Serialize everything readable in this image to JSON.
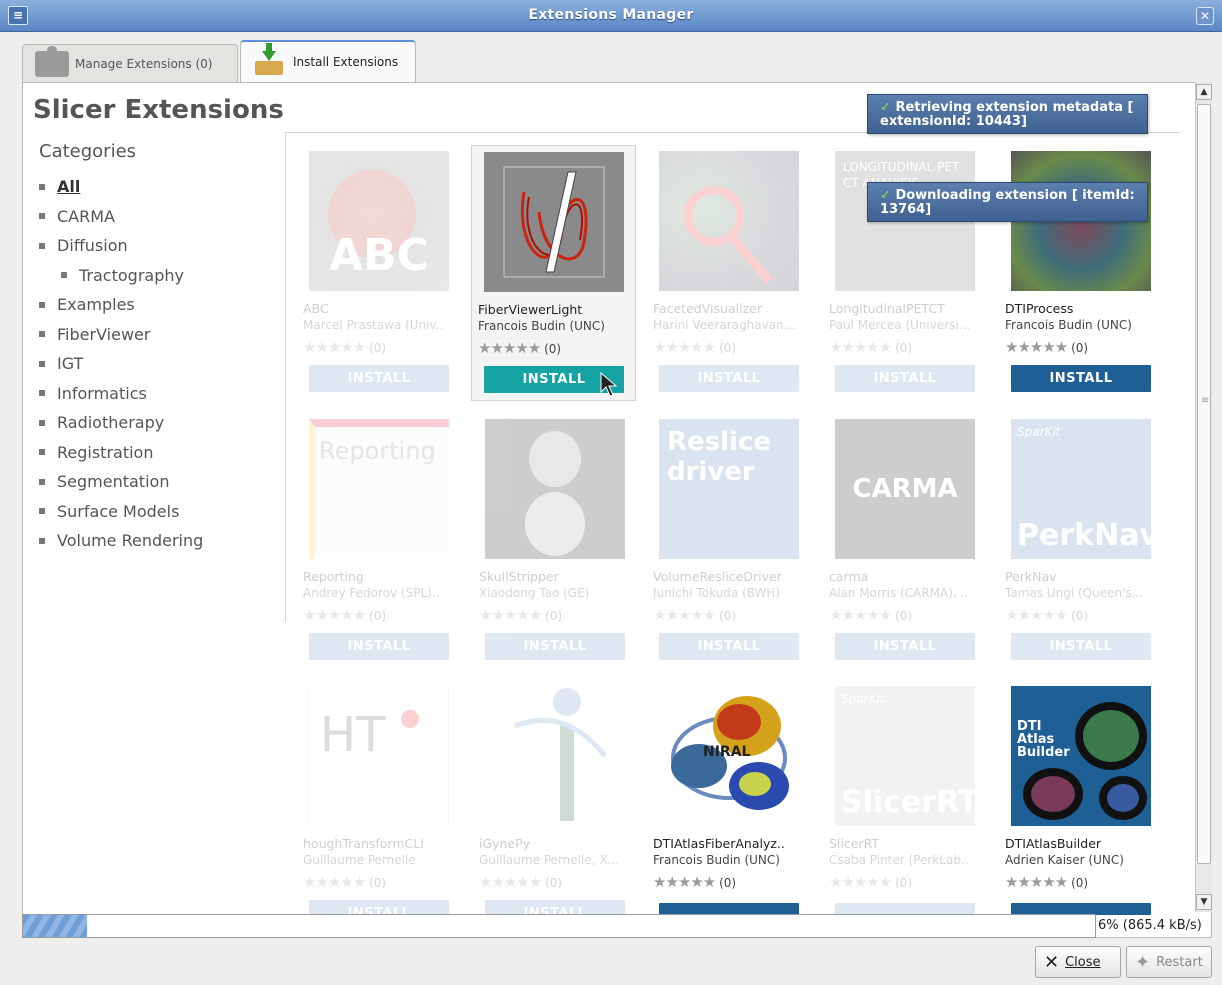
{
  "window": {
    "title": "Extensions Manager"
  },
  "tabs": [
    {
      "label": "Manage Extensions (0)"
    },
    {
      "label": "Install Extensions"
    }
  ],
  "main": {
    "heading": "Slicer Extensions",
    "categories_title": "Categories",
    "categories": [
      {
        "label": "All",
        "active": true
      },
      {
        "label": "CARMA"
      },
      {
        "label": "Diffusion"
      },
      {
        "label": "Tractography",
        "sub": true
      },
      {
        "label": "Examples"
      },
      {
        "label": "FiberViewer"
      },
      {
        "label": "IGT"
      },
      {
        "label": "Informatics"
      },
      {
        "label": "Radiotherapy"
      },
      {
        "label": "Registration"
      },
      {
        "label": "Segmentation"
      },
      {
        "label": "Surface Models"
      },
      {
        "label": "Volume Rendering"
      }
    ],
    "install_label": "INSTALL",
    "extensions": [
      {
        "name": "ABC",
        "author": "Marcel Prastawa (Univ..",
        "rating": "(0)",
        "thumb_text": "ABC"
      },
      {
        "name": "FiberViewerLight",
        "author": "Francois Budin (UNC)",
        "rating": "(0)"
      },
      {
        "name": "FacetedVisualizer",
        "author": "Harini Veeraraghavan...",
        "rating": "(0)"
      },
      {
        "name": "LongitudinalPETCT",
        "author": "Paul Mercea (Universi...",
        "rating": "(0)",
        "thumb_text": "LONGITUDINAL PET CT ANALYSIS"
      },
      {
        "name": "DTIProcess",
        "author": "Francois Budin (UNC)",
        "rating": "(0)"
      },
      {
        "name": "Reporting",
        "author": "Andrey Fedorov (SPL)..",
        "rating": "(0)",
        "thumb_text": "Reporting"
      },
      {
        "name": "SkullStripper",
        "author": "Xiaodong Tao (GE)",
        "rating": "(0)"
      },
      {
        "name": "VolumeResliceDriver",
        "author": "Junichi Tokuda (BWH)",
        "rating": "(0)",
        "thumb_text": "Reslice driver"
      },
      {
        "name": "carma",
        "author": "Alan Morris (CARMA), ..",
        "rating": "(0)",
        "thumb_text": "CARMA"
      },
      {
        "name": "PerkNav",
        "author": "Tamas Ungi (Queen's...",
        "rating": "(0)",
        "thumb_text": "PerkNav"
      },
      {
        "name": "houghTransformCLI",
        "author": "Guillaume Pernelle",
        "rating": "(0)",
        "thumb_text": "HT"
      },
      {
        "name": "iGynePy",
        "author": "Guillaume Pernelle, X...",
        "rating": "(0)"
      },
      {
        "name": "DTIAtlasFiberAnalyz..",
        "author": "Francois Budin (UNC)",
        "rating": "(0)",
        "thumb_text": "NIRAL"
      },
      {
        "name": "SlicerRT",
        "author": "Csaba Pinter (PerkLab..",
        "rating": "(0)",
        "thumb_text": "SlicerRT"
      },
      {
        "name": "DTIAtlasBuilder",
        "author": "Adrien Kaiser (UNC)",
        "rating": "(0)",
        "thumb_text": "DTI Atlas Builder"
      }
    ],
    "sparkit_label": "SparKit"
  },
  "notifications": [
    {
      "text": "Retrieving extension metadata [ extensionId: 10443]"
    },
    {
      "text": "Downloading extension [ itemId: 13764]"
    }
  ],
  "progress": {
    "percent": 6,
    "label": "6% (865.4 kB/s)"
  },
  "buttons": {
    "close": "Close",
    "restart": "Restart"
  },
  "colors": {
    "accent": "#1e5f96",
    "hover_install": "#15a2a2",
    "titlebar": "#5a86c4"
  }
}
